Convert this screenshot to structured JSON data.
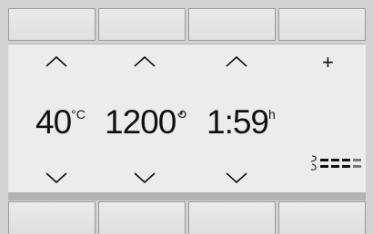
{
  "display": {
    "temperature": {
      "value": "40",
      "unit": "°C"
    },
    "speed": {
      "value": "1200"
    },
    "time": {
      "value": "1:59",
      "unit": "h"
    },
    "plus_label": "+",
    "spin_level": 3
  },
  "colors": {
    "panel": "#d2d2d2",
    "screen": "#ececec",
    "ink": "#111111"
  },
  "icons": [
    "chevron-up-icon",
    "chevron-down-icon",
    "spin-icon",
    "fan-speed-icon"
  ]
}
